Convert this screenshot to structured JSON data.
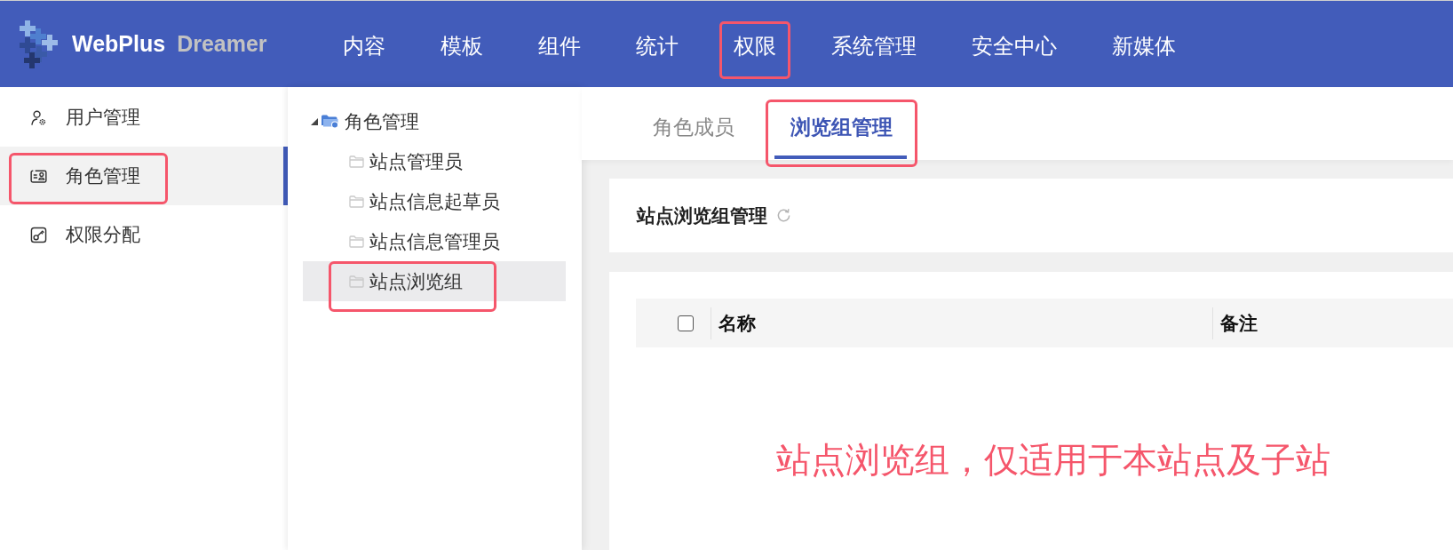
{
  "header": {
    "logo": {
      "brand": "WebPlus",
      "product": "Dreamer"
    },
    "nav": [
      {
        "label": "内容",
        "highlighted": false
      },
      {
        "label": "模板",
        "highlighted": false
      },
      {
        "label": "组件",
        "highlighted": false
      },
      {
        "label": "统计",
        "highlighted": false
      },
      {
        "label": "权限",
        "highlighted": true
      },
      {
        "label": "系统管理",
        "highlighted": false
      },
      {
        "label": "安全中心",
        "highlighted": false
      },
      {
        "label": "新媒体",
        "highlighted": false
      }
    ]
  },
  "sidebar": {
    "items": [
      {
        "label": "用户管理",
        "selected": false,
        "highlighted": false
      },
      {
        "label": "角色管理",
        "selected": true,
        "highlighted": true
      },
      {
        "label": "权限分配",
        "selected": false,
        "highlighted": false
      }
    ]
  },
  "tree": {
    "root": {
      "label": "角色管理",
      "expanded": true,
      "selected": false,
      "highlighted": false,
      "children": [
        {
          "label": "站点管理员",
          "selected": false,
          "highlighted": false
        },
        {
          "label": "站点信息起草员",
          "selected": false,
          "highlighted": false
        },
        {
          "label": "站点信息管理员",
          "selected": false,
          "highlighted": false
        },
        {
          "label": "站点浏览组",
          "selected": true,
          "highlighted": true
        }
      ]
    }
  },
  "tabs": [
    {
      "label": "角色成员",
      "selected": false,
      "highlighted": false
    },
    {
      "label": "浏览组管理",
      "selected": true,
      "highlighted": true
    }
  ],
  "panel": {
    "title": "站点浏览组管理"
  },
  "table": {
    "select_all": {
      "checked": false
    },
    "columns": [
      "名称",
      "备注"
    ]
  },
  "note": "站点浏览组，仅适用于本站点及子站"
}
